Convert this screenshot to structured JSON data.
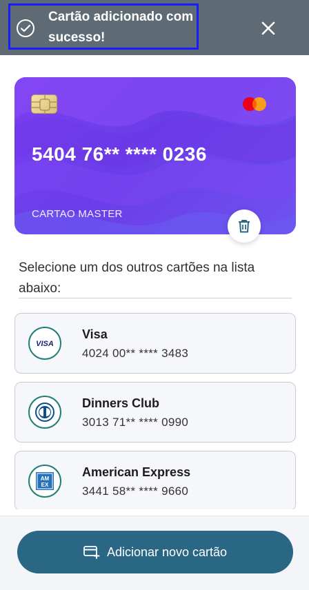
{
  "toast": {
    "message": "Cartão adicionado com sucesso!",
    "icon": "check-circle-icon",
    "close_icon": "close-icon"
  },
  "selected_card": {
    "number": "5404 76** **** 0236",
    "holder": "CARTAO MASTER",
    "brand": "mastercard",
    "chip_icon": "chip-icon",
    "delete_icon": "trash-icon"
  },
  "select_label": "Selecione um dos outros cartões na lista abaixo:",
  "cards": [
    {
      "name": "Visa",
      "number": "4024 00** **** 3483",
      "logo_text": "VISA"
    },
    {
      "name": "Dinners Club",
      "number": "3013 71** **** 0990",
      "logo_text": ""
    },
    {
      "name": "American Express",
      "number": "3441 58** **** 9660",
      "logo_text": "AM EX"
    }
  ],
  "add_button": {
    "label": "Adicionar novo cartão",
    "icon": "add-card-icon"
  },
  "colors": {
    "toast_bg": "#5f6b74",
    "card_purple": "#7b3ff2",
    "accent_teal": "#1f7f76",
    "button_blue": "#2a6784"
  }
}
